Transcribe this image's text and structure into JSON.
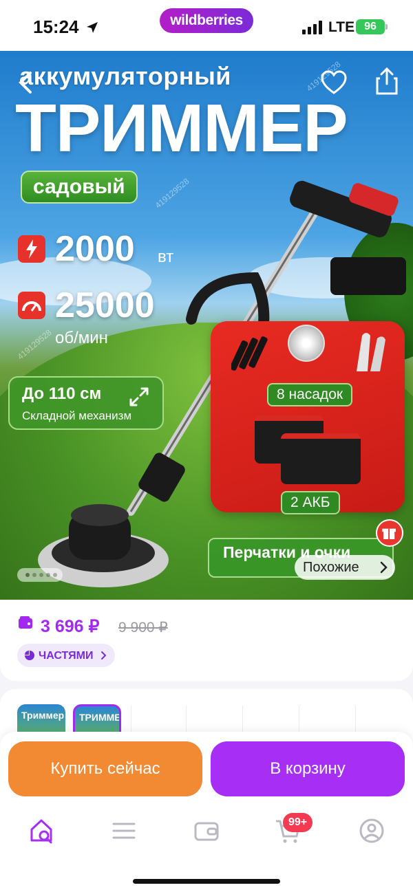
{
  "status_bar": {
    "time": "15:24",
    "brand": "wildberries",
    "network": "LTE",
    "battery": "96"
  },
  "hero": {
    "subtitle": "аккумуляторный",
    "title": "ТРИММЕР",
    "badge": "садовый",
    "spec_power_value": "2000",
    "spec_power_unit": "вт",
    "spec_speed_value": "25000",
    "spec_speed_unit": "об/мин",
    "fold_title": "До 110 см",
    "fold_subtitle": "Складной механизм",
    "attachments_label": "8 насадок",
    "batteries_label": "2 АКБ",
    "gloves_label": "Перчатки и очки",
    "similar_label": "Похожие",
    "watermark": "419129528",
    "slides_total": 5,
    "slide_current": 1
  },
  "price": {
    "current": "3 696 ₽",
    "old": "9 900 ₽",
    "installments_label": "ЧАСТЯМИ"
  },
  "gallery": {
    "thumb_1_text": "Триммер",
    "thumb_2_text": "ТРИММЕ"
  },
  "actions": {
    "buy_now": "Купить сейчас",
    "add_to_cart": "В корзину"
  },
  "tabbar": {
    "cart_badge": "99+"
  },
  "colors": {
    "accent": "#a62ef5",
    "buy": "#f28a34",
    "price": "#a429f0"
  }
}
